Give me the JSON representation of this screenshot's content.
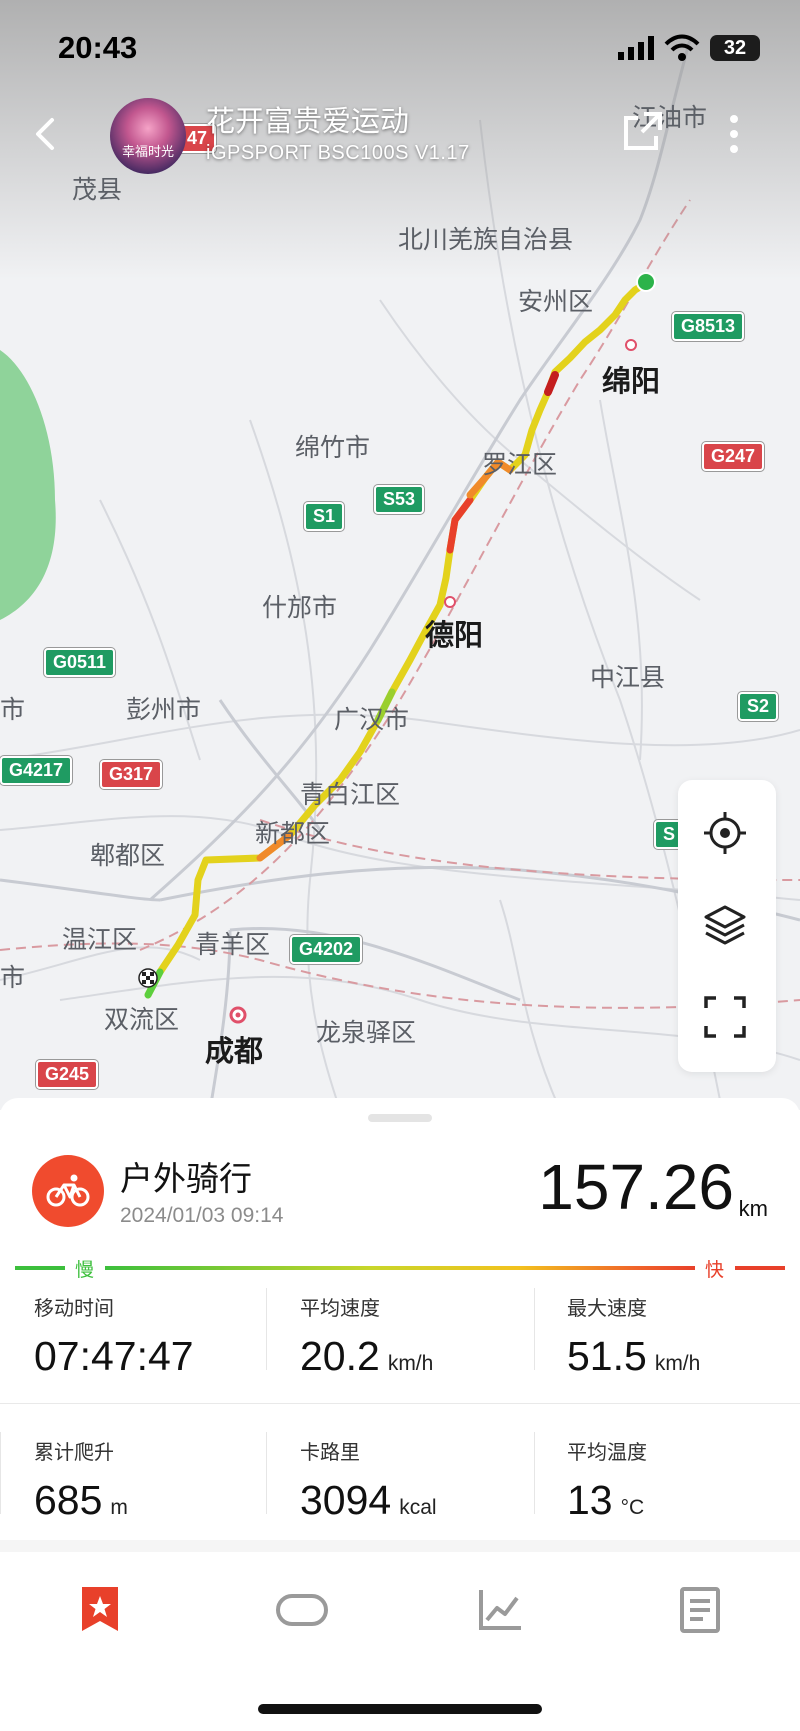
{
  "status_bar": {
    "time": "20:43",
    "battery": "32"
  },
  "header": {
    "title": "花开富贵爱运动",
    "subtitle": "iGPSPORT BSC100S V1.17",
    "avatar_caption": "幸福时光"
  },
  "map": {
    "places": [
      "江油市",
      "茂县",
      "北川羌族自治县",
      "安州区",
      "绵阳",
      "绵竹市",
      "罗江区",
      "什邡市",
      "德阳",
      "中江县",
      "彭州市",
      "广汉市",
      "青白江区",
      "新都区",
      "郫都区",
      "温江区",
      "青羊区",
      "双流区",
      "成都",
      "龙泉驿区",
      "市",
      "市"
    ],
    "road_shields": [
      "G8513",
      "G247",
      "S53",
      "S1",
      "G0511",
      "G4217",
      "G317",
      "G4202",
      "S2",
      "G245",
      "S",
      "47"
    ]
  },
  "activity": {
    "type_label": "户外骑行",
    "datetime": "2024/01/03 09:14",
    "distance": "157.26",
    "distance_unit": "km"
  },
  "speed_legend": {
    "slow": "慢",
    "fast": "快"
  },
  "stats": [
    {
      "label": "移动时间",
      "value": "07:47:47",
      "unit": ""
    },
    {
      "label": "平均速度",
      "value": "20.2",
      "unit": "km/h"
    },
    {
      "label": "最大速度",
      "value": "51.5",
      "unit": "km/h"
    },
    {
      "label": "累计爬升",
      "value": "685",
      "unit": "m"
    },
    {
      "label": "卡路里",
      "value": "3094",
      "unit": "kcal"
    },
    {
      "label": "平均温度",
      "value": "13",
      "unit": "°C"
    }
  ],
  "colors": {
    "accent": "#f04b2e",
    "slow": "#3cbf3c",
    "fast": "#e8402a"
  },
  "icons": {
    "back": "back-arrow-icon",
    "share": "share-icon",
    "more": "more-vertical-icon",
    "locate": "locate-icon",
    "layers": "layers-icon",
    "fullscreen": "fullscreen-icon",
    "bike": "bicycle-icon",
    "tab_overview": "star-badge-icon",
    "tab_laps": "laps-icon",
    "tab_chart": "line-chart-icon",
    "tab_detail": "document-icon"
  }
}
